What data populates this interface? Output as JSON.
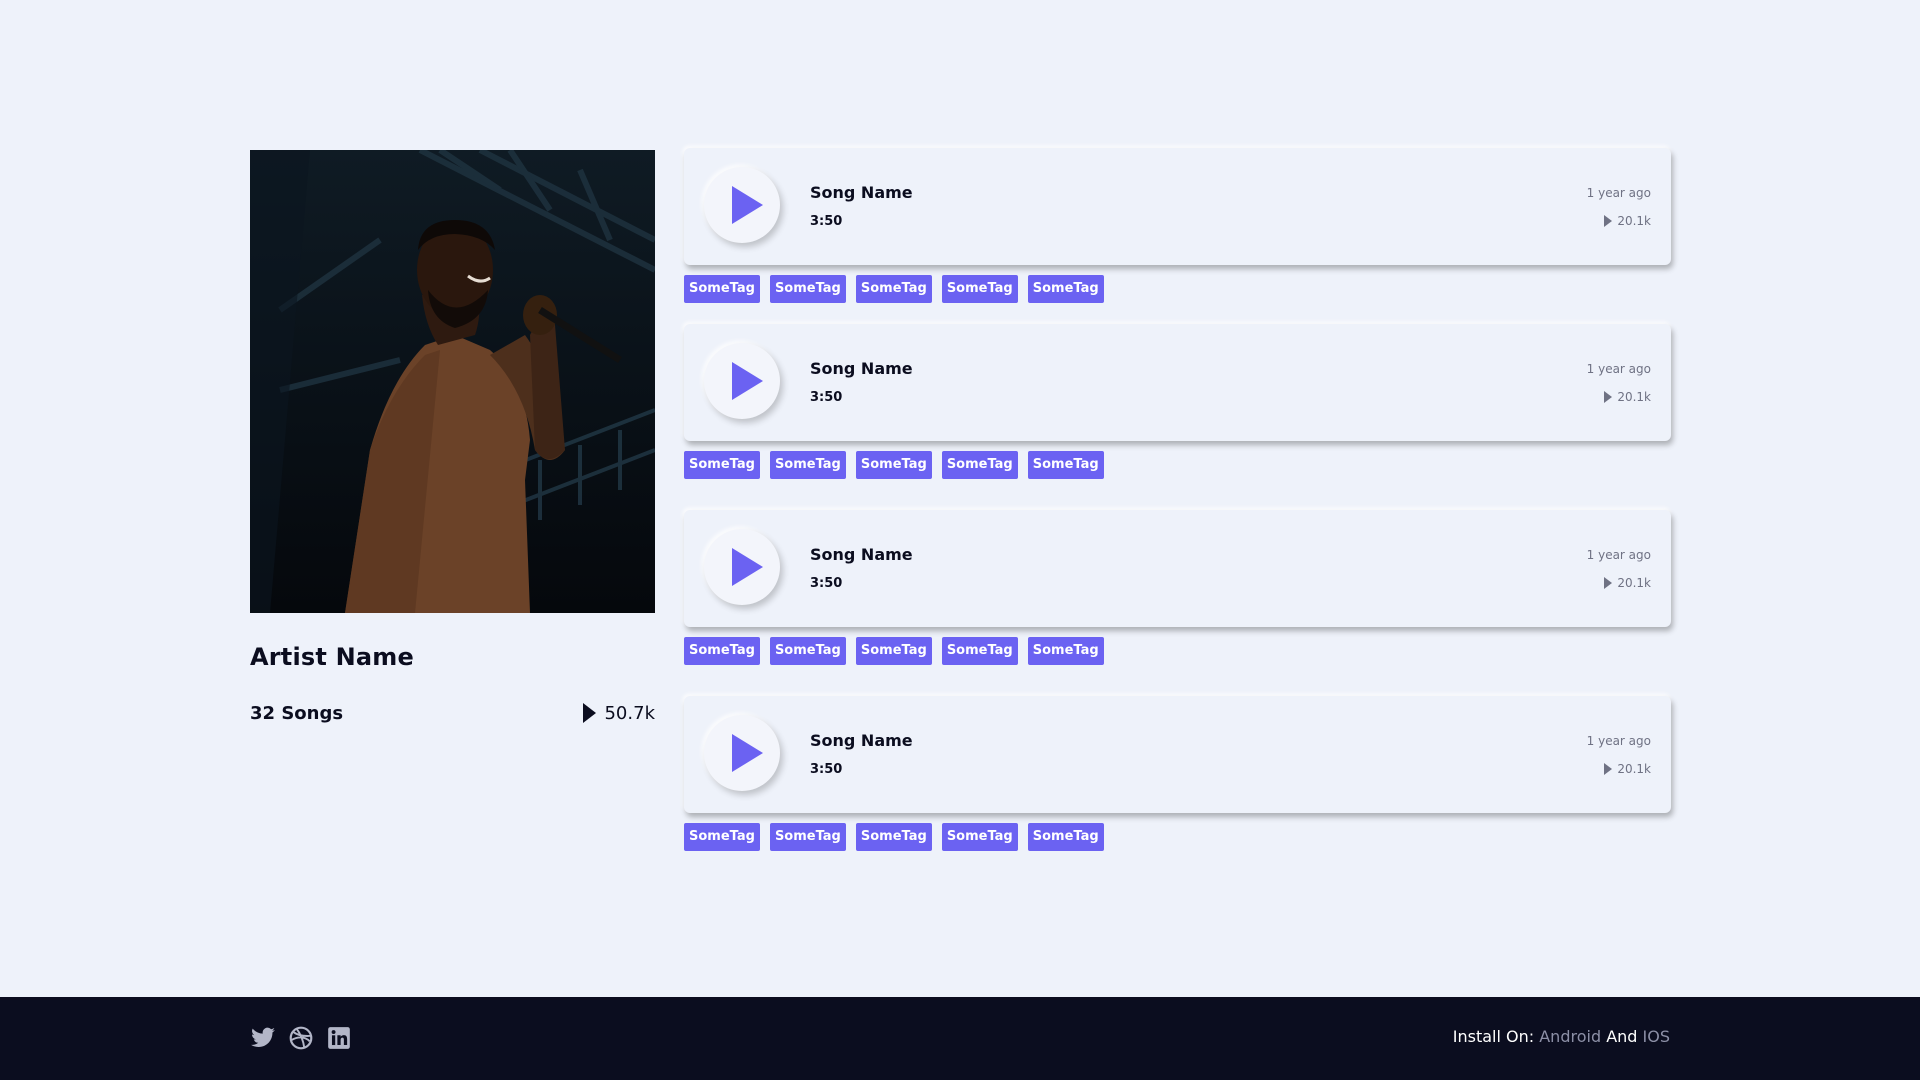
{
  "artist": {
    "name": "Artist Name",
    "songs_count": "32 Songs",
    "total_plays": "50.7k",
    "photo_icon": "singer-photo"
  },
  "songs": [
    {
      "title": "Song Name",
      "duration": "3:50",
      "age": "1 year ago",
      "plays": "20.1k",
      "tags": [
        "SomeTag",
        "SomeTag",
        "SomeTag",
        "SomeTag",
        "SomeTag"
      ]
    },
    {
      "title": "Song Name",
      "duration": "3:50",
      "age": "1 year ago",
      "plays": "20.1k",
      "tags": [
        "SomeTag",
        "SomeTag",
        "SomeTag",
        "SomeTag",
        "SomeTag"
      ]
    },
    {
      "title": "Song Name",
      "duration": "3:50",
      "age": "1 year ago",
      "plays": "20.1k",
      "tags": [
        "SomeTag",
        "SomeTag",
        "SomeTag",
        "SomeTag",
        "SomeTag"
      ]
    },
    {
      "title": "Song Name",
      "duration": "3:50",
      "age": "1 year ago",
      "plays": "20.1k",
      "tags": [
        "SomeTag",
        "SomeTag",
        "SomeTag",
        "SomeTag",
        "SomeTag"
      ]
    }
  ],
  "footer": {
    "social_icons": [
      "twitter-icon",
      "dribbble-icon",
      "linkedin-icon"
    ],
    "install_prefix": "Install On:",
    "android": "Android",
    "conjunction": "And",
    "ios": "IOS"
  },
  "colors": {
    "background": "#eef2fa",
    "accent": "#6b62f2",
    "footer": "#0b0d1f",
    "text": "#0b0d1f",
    "muted": "#6f7284"
  }
}
